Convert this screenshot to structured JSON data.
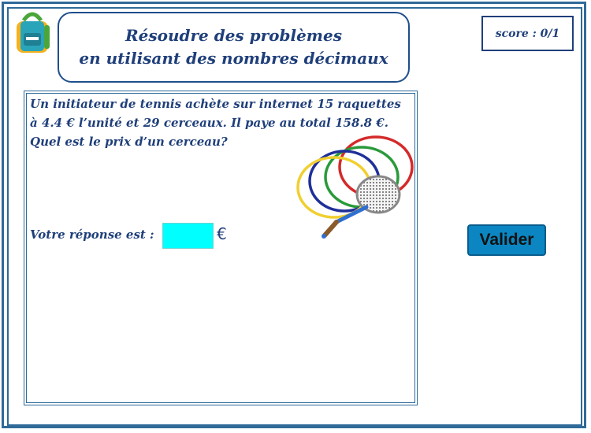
{
  "header": {
    "title_line1": "Résoudre des problèmes",
    "title_line2": "en utilisant des nombres décimaux"
  },
  "score": {
    "label": "score : 0/1"
  },
  "problem": {
    "line1": "Un initiateur de tennis achète sur internet 15 raquettes",
    "line2": "à 4.4 € l’unité et 29 cerceaux. Il paye au total 158.8 €.",
    "line3": "Quel est le prix d’un cerceau?"
  },
  "answer": {
    "label": "Votre réponse est :",
    "value": "",
    "currency": "€"
  },
  "actions": {
    "validate_label": "Valider"
  },
  "icons": {
    "logo": "backpack-icon",
    "illustration": "hoops-and-racket"
  },
  "colors": {
    "primary": "#1f3f7a",
    "input_bg": "#00ffff",
    "button_bg": "#0b86c2"
  }
}
